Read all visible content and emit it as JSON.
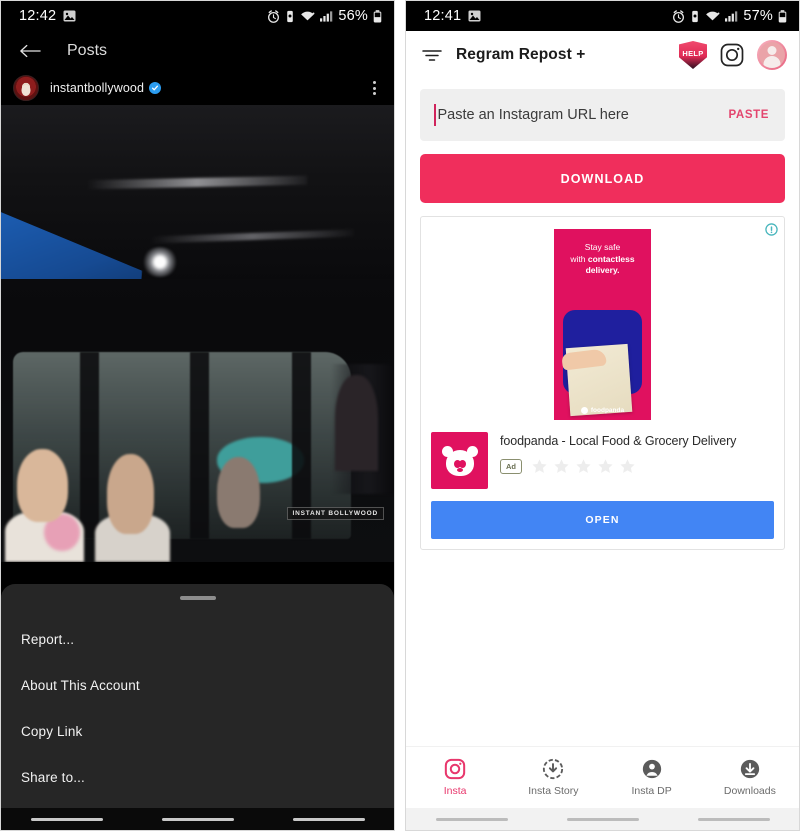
{
  "left_phone": {
    "status_bar": {
      "time": "12:42",
      "battery": "56%",
      "icons": [
        "image-icon",
        "alarm-icon",
        "vibrate-icon",
        "wifi-icon",
        "signal-icon",
        "battery-icon"
      ]
    },
    "app_bar": {
      "back_label": "back-arrow",
      "title": "Posts"
    },
    "post": {
      "username": "instantbollywood",
      "verified": true,
      "menu": "more-options",
      "watermark": "INSTANT BOLLYWOOD"
    },
    "bottom_sheet": {
      "items": [
        {
          "label": "Report..."
        },
        {
          "label": "About This Account"
        },
        {
          "label": "Copy Link"
        },
        {
          "label": "Share to..."
        }
      ]
    }
  },
  "right_phone": {
    "status_bar": {
      "time": "12:41",
      "battery": "57%"
    },
    "app_bar": {
      "title": "Regram Repost +",
      "menu_icon": "filter-menu-icon",
      "help_label": "HELP",
      "instagram_icon": "instagram-icon",
      "avatar": "profile-avatar"
    },
    "url_input": {
      "placeholder": "Paste an Instagram URL here",
      "value": "",
      "paste_label": "PASTE"
    },
    "download_button": {
      "label": "DOWNLOAD"
    },
    "ad": {
      "adchoices_icon": "info-icon",
      "banner": {
        "line1": "Stay safe",
        "line2_pre": "with ",
        "line2_strong": "contactless",
        "line3": "delivery.",
        "brand": "foodpanda"
      },
      "title": "foodpanda - Local Food & Grocery Delivery",
      "badge": "Ad",
      "rating_stars": 5,
      "rating_filled": 0,
      "cta_label": "OPEN"
    },
    "bottom_nav": {
      "items": [
        {
          "label": "Insta",
          "icon": "instagram-icon",
          "active": true
        },
        {
          "label": "Insta Story",
          "icon": "story-download-icon",
          "active": false
        },
        {
          "label": "Insta DP",
          "icon": "profile-download-icon",
          "active": false
        },
        {
          "label": "Downloads",
          "icon": "download-circle-icon",
          "active": false
        }
      ]
    }
  },
  "colors": {
    "accent_pink": "#f02e5c",
    "paste_pink": "#e3456e",
    "open_blue": "#4285f4",
    "foodpanda_pink": "#e0115f",
    "nav_active": "#e8376c",
    "sheet_bg": "#262626"
  }
}
